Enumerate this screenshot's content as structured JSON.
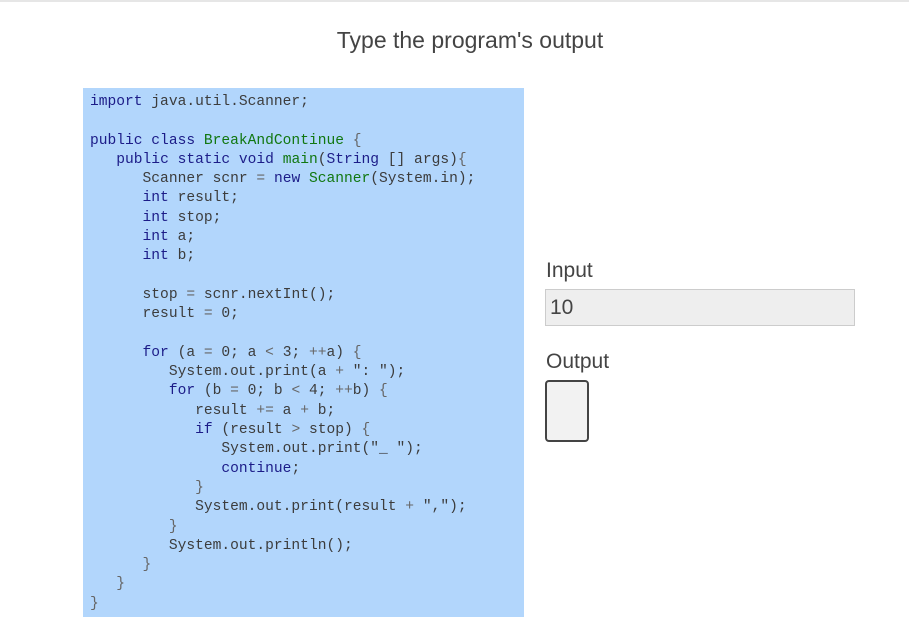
{
  "header": {
    "title": "Type the program's output"
  },
  "code": {
    "lines": [
      "import java.util.Scanner;",
      "",
      "public class BreakAndContinue {",
      "   public static void main(String [] args){",
      "      Scanner scnr = new Scanner(System.in);",
      "      int result;",
      "      int stop;",
      "      int a;",
      "      int b;",
      "",
      "      stop = scnr.nextInt();",
      "      result = 0;",
      "",
      "      for (a = 0; a < 3; ++a) {",
      "         System.out.print(a + \": \");",
      "         for (b = 0; b < 4; ++b) {",
      "            result += a + b;",
      "            if (result > stop) {",
      "               System.out.print(\"_ \");",
      "               continue;",
      "            }",
      "            System.out.print(result + \",\");",
      "         }",
      "         System.out.println();",
      "      }",
      "   }",
      "}"
    ]
  },
  "input": {
    "label": "Input",
    "value": "10"
  },
  "output": {
    "label": "Output",
    "value": ""
  },
  "colors": {
    "code_background": "#b2d6fc",
    "keyword": "#1c1c88",
    "type": "#117711"
  }
}
